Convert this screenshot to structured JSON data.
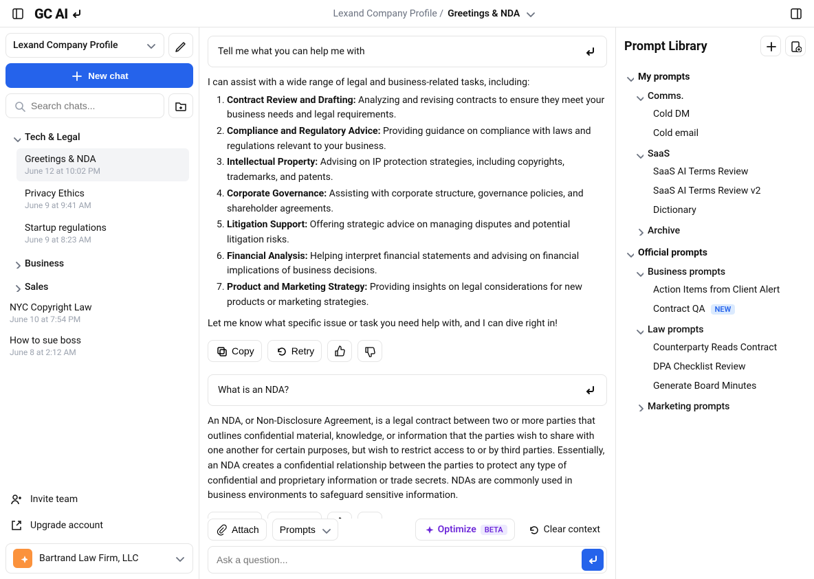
{
  "app": {
    "logo": "GC AI"
  },
  "breadcrumb": {
    "main": "Lexand Company Profile /",
    "sub": "Greetings & NDA"
  },
  "sidebar": {
    "profile": "Lexand Company Profile",
    "newchat": "New chat",
    "search_placeholder": "Search chats...",
    "groups": [
      {
        "name": "Tech & Legal",
        "open": true,
        "items": [
          {
            "title": "Greetings & NDA",
            "date": "June 12 at 10:02 PM",
            "active": true
          },
          {
            "title": "Privacy Ethics",
            "date": "June 9 at 9:41 AM"
          },
          {
            "title": "Startup regulations",
            "date": "June 9 at 8:23 AM"
          }
        ]
      },
      {
        "name": "Business",
        "open": false
      },
      {
        "name": "Sales",
        "open": false
      }
    ],
    "unstructured": [
      {
        "title": "NYC Copyright Law",
        "date": "June 10 at 7:54 PM"
      },
      {
        "title": "How to sue boss",
        "date": "June 8 at 2:12 AM"
      }
    ],
    "invite": "Invite team",
    "upgrade": "Upgrade account",
    "account": "Bartrand Law Firm, LLC"
  },
  "chat": {
    "q1": "Tell me what you can help me with",
    "a1": {
      "lead": "I can assist with a wide range of legal and business-related tasks, including:",
      "items": [
        {
          "b": "Contract Review and Drafting:",
          "t": " Analyzing and revising contracts to ensure they meet your business needs and legal requirements."
        },
        {
          "b": "Compliance and Regulatory Advice:",
          "t": " Providing guidance on compliance with laws and regulations relevant to your business."
        },
        {
          "b": "Intellectual Property:",
          "t": " Advising on IP protection strategies, including copyrights, trademarks, and patents."
        },
        {
          "b": "Corporate Governance:",
          "t": " Assisting with corporate structure, governance policies, and shareholder agreements."
        },
        {
          "b": "Litigation Support:",
          "t": " Offering strategic advice on managing disputes and potential litigation risks."
        },
        {
          "b": "Financial Analysis:",
          "t": " Helping interpret financial statements and advising on financial implications of business decisions."
        },
        {
          "b": "Product and Marketing Strategy:",
          "t": " Providing insights on legal considerations for new products or marketing strategies."
        }
      ],
      "trail": "Let me know what specific issue or task you need help with, and I can dive right in!"
    },
    "q2": "What is an NDA?",
    "a2": "An NDA, or Non-Disclosure Agreement, is a legal contract between two or more parties that outlines confidential material, knowledge, or information that the parties wish to share with one another for certain purposes, but wish to restrict access to or by third parties. Essentially, an NDA creates a confidential relationship between the parties to protect any type of confidential and proprietary information or trade secrets. NDAs are commonly used in business environments to safeguard sensitive information.",
    "actions": {
      "copy": "Copy",
      "retry": "Retry"
    }
  },
  "composer": {
    "attach": "Attach",
    "prompts": "Prompts",
    "optimize": "Optimize",
    "optimize_badge": "BETA",
    "clear": "Clear context",
    "placeholder": "Ask a question..."
  },
  "right": {
    "title": "Prompt Library",
    "sections": [
      {
        "name": "My prompts",
        "open": true,
        "subs": [
          {
            "name": "Comms.",
            "open": true,
            "items": [
              {
                "label": "Cold DM"
              },
              {
                "label": "Cold email"
              }
            ]
          },
          {
            "name": "SaaS",
            "open": true,
            "items": [
              {
                "label": "SaaS AI Terms Review"
              },
              {
                "label": "SaaS AI Terms Review v2"
              },
              {
                "label": "Dictionary"
              }
            ]
          },
          {
            "name": "Archive",
            "open": false
          }
        ]
      },
      {
        "name": "Official prompts",
        "open": true,
        "subs": [
          {
            "name": "Business prompts",
            "open": true,
            "items": [
              {
                "label": "Action Items from Client Alert"
              },
              {
                "label": "Contract QA",
                "badge": "NEW"
              }
            ]
          },
          {
            "name": "Law prompts",
            "open": true,
            "items": [
              {
                "label": "Counterparty Reads Contract"
              },
              {
                "label": "DPA Checklist Review"
              },
              {
                "label": "Generate Board Minutes"
              }
            ]
          },
          {
            "name": "Marketing prompts",
            "open": false
          }
        ]
      }
    ]
  }
}
